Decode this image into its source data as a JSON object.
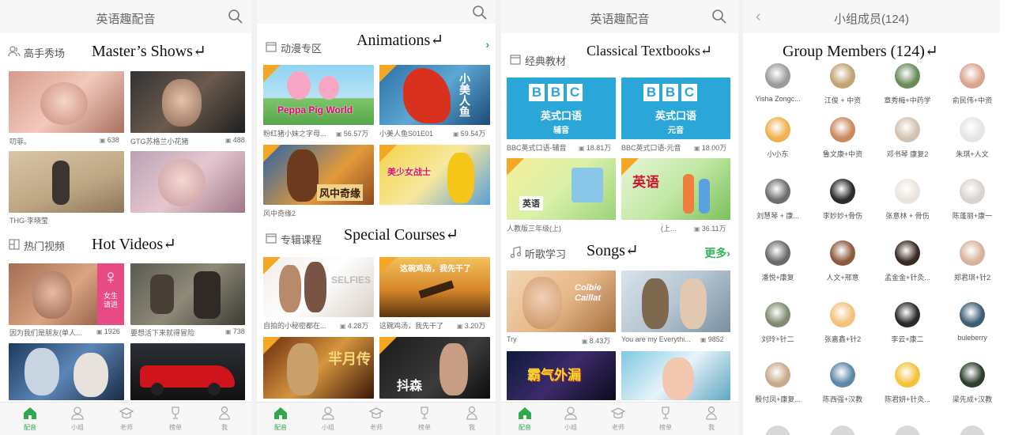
{
  "panel1": {
    "title": "英语趣配音",
    "sec1": {
      "label": "高手秀场",
      "eng": "Master’s Shows↵"
    },
    "sec1_items": [
      {
        "caption": "叨菲。",
        "count": "638"
      },
      {
        "caption": "GTG苏格兰小花猪",
        "count": "488"
      },
      {
        "caption": "THG-李晓莹",
        "count": ""
      },
      {
        "caption": "",
        "count": ""
      }
    ],
    "sec2": {
      "label": "热门视频",
      "eng": "Hot Videos↵"
    },
    "sec2_items": [
      {
        "caption": "因为我们是朋友(单人...",
        "count": "1926",
        "badge": "女生请进",
        "symbol": "♀"
      },
      {
        "caption": "要想活下来就得冒险",
        "count": "738"
      },
      {
        "caption": "",
        "count": ""
      },
      {
        "caption": "",
        "count": ""
      }
    ],
    "tabs": [
      "配音",
      "小组",
      "老师",
      "榜单",
      "我"
    ]
  },
  "panel2": {
    "sec1": {
      "label": "动漫专区",
      "eng": "Animations↵"
    },
    "sec1_items": [
      {
        "caption": "粉红猪小妹之字母...",
        "count": "56.57万",
        "art": "Peppa Pig World"
      },
      {
        "caption": "小美人鱼S01E01",
        "count": "59.54万",
        "art": "小美人鱼"
      },
      {
        "caption": "风中奇缘2",
        "count": "",
        "art": "风中奇缘"
      },
      {
        "caption": "",
        "count": "",
        "art": "美少女战士"
      }
    ],
    "sec2": {
      "label": "专辑课程",
      "eng": "Special Courses↵"
    },
    "sec2_items": [
      {
        "caption": "自拍的小秘密都在...",
        "count": "4.28万",
        "art": "SELFIES"
      },
      {
        "caption": "这碗鸡汤，我先干了",
        "count": "3.20万",
        "art": "这碗鸡汤，我先干了"
      },
      {
        "caption": "",
        "count": "",
        "art": "羋月传"
      },
      {
        "caption": "",
        "count": "",
        "art": "抖森"
      }
    ],
    "tabs": [
      "配音",
      "小组",
      "老师",
      "榜单",
      "我"
    ]
  },
  "panel3": {
    "title": "英语趣配音",
    "sec1": {
      "label": "经典教材",
      "eng": "Classical Textbooks↵"
    },
    "sec1_items": [
      {
        "caption": "BBC英式口语-辅音",
        "count": "18.81万",
        "line1": "英式口语",
        "line2": "辅音"
      },
      {
        "caption": "BBC英式口语-元音",
        "count": "18.00万",
        "line1": "英式口语",
        "line2": "元音"
      },
      {
        "caption": "人教版三年级(上)",
        "count": "",
        "art": "英语"
      },
      {
        "caption": "(上...",
        "count": "36.11万",
        "art": "英语"
      }
    ],
    "bbc": [
      "B",
      "B",
      "C"
    ],
    "sec2": {
      "label": "听歌学习",
      "eng": "Songs↵",
      "more": "更多"
    },
    "sec2_items": [
      {
        "caption": "Try",
        "count": "8.43万",
        "art": "Colbie Caillat"
      },
      {
        "caption": "You are my Everythi...",
        "count": "9852",
        "art": ""
      },
      {
        "caption": "",
        "count": "",
        "art": "霸气外漏"
      },
      {
        "caption": "",
        "count": "",
        "art": ""
      }
    ],
    "tabs": [
      "配音",
      "小组",
      "老师",
      "榜单",
      "我"
    ]
  },
  "panel4": {
    "title": "小组成员(124)",
    "eng": "Group Members (124)↵",
    "members": [
      "Yisha Zongc...",
      "江俊 + 中资",
      "章秀梅+中药学",
      "俞民伟+中资",
      "小小东",
      "鲁文康+中资",
      "邓书琴 康复2",
      "朱琪+人文",
      "刘慧琴 + 康...",
      "李妙妙+骨伤",
      "张意林 + 骨伤",
      "陈蓬丽+康一",
      "潘悦+康复",
      "人文+邢意",
      "孟金金+针灸...",
      "郑君琪+针2",
      "刘玲+针二",
      "张嘉鑫+针2",
      "李云+康二",
      "buleberry",
      "殷付凤+康复...",
      "陈西强+汉教",
      "陈君妍+针灸...",
      "梁先成+汉教"
    ]
  },
  "colors": {
    "accent": "#2fa84f",
    "tag": "#f5a623",
    "bbc": "#2aa6d8"
  }
}
